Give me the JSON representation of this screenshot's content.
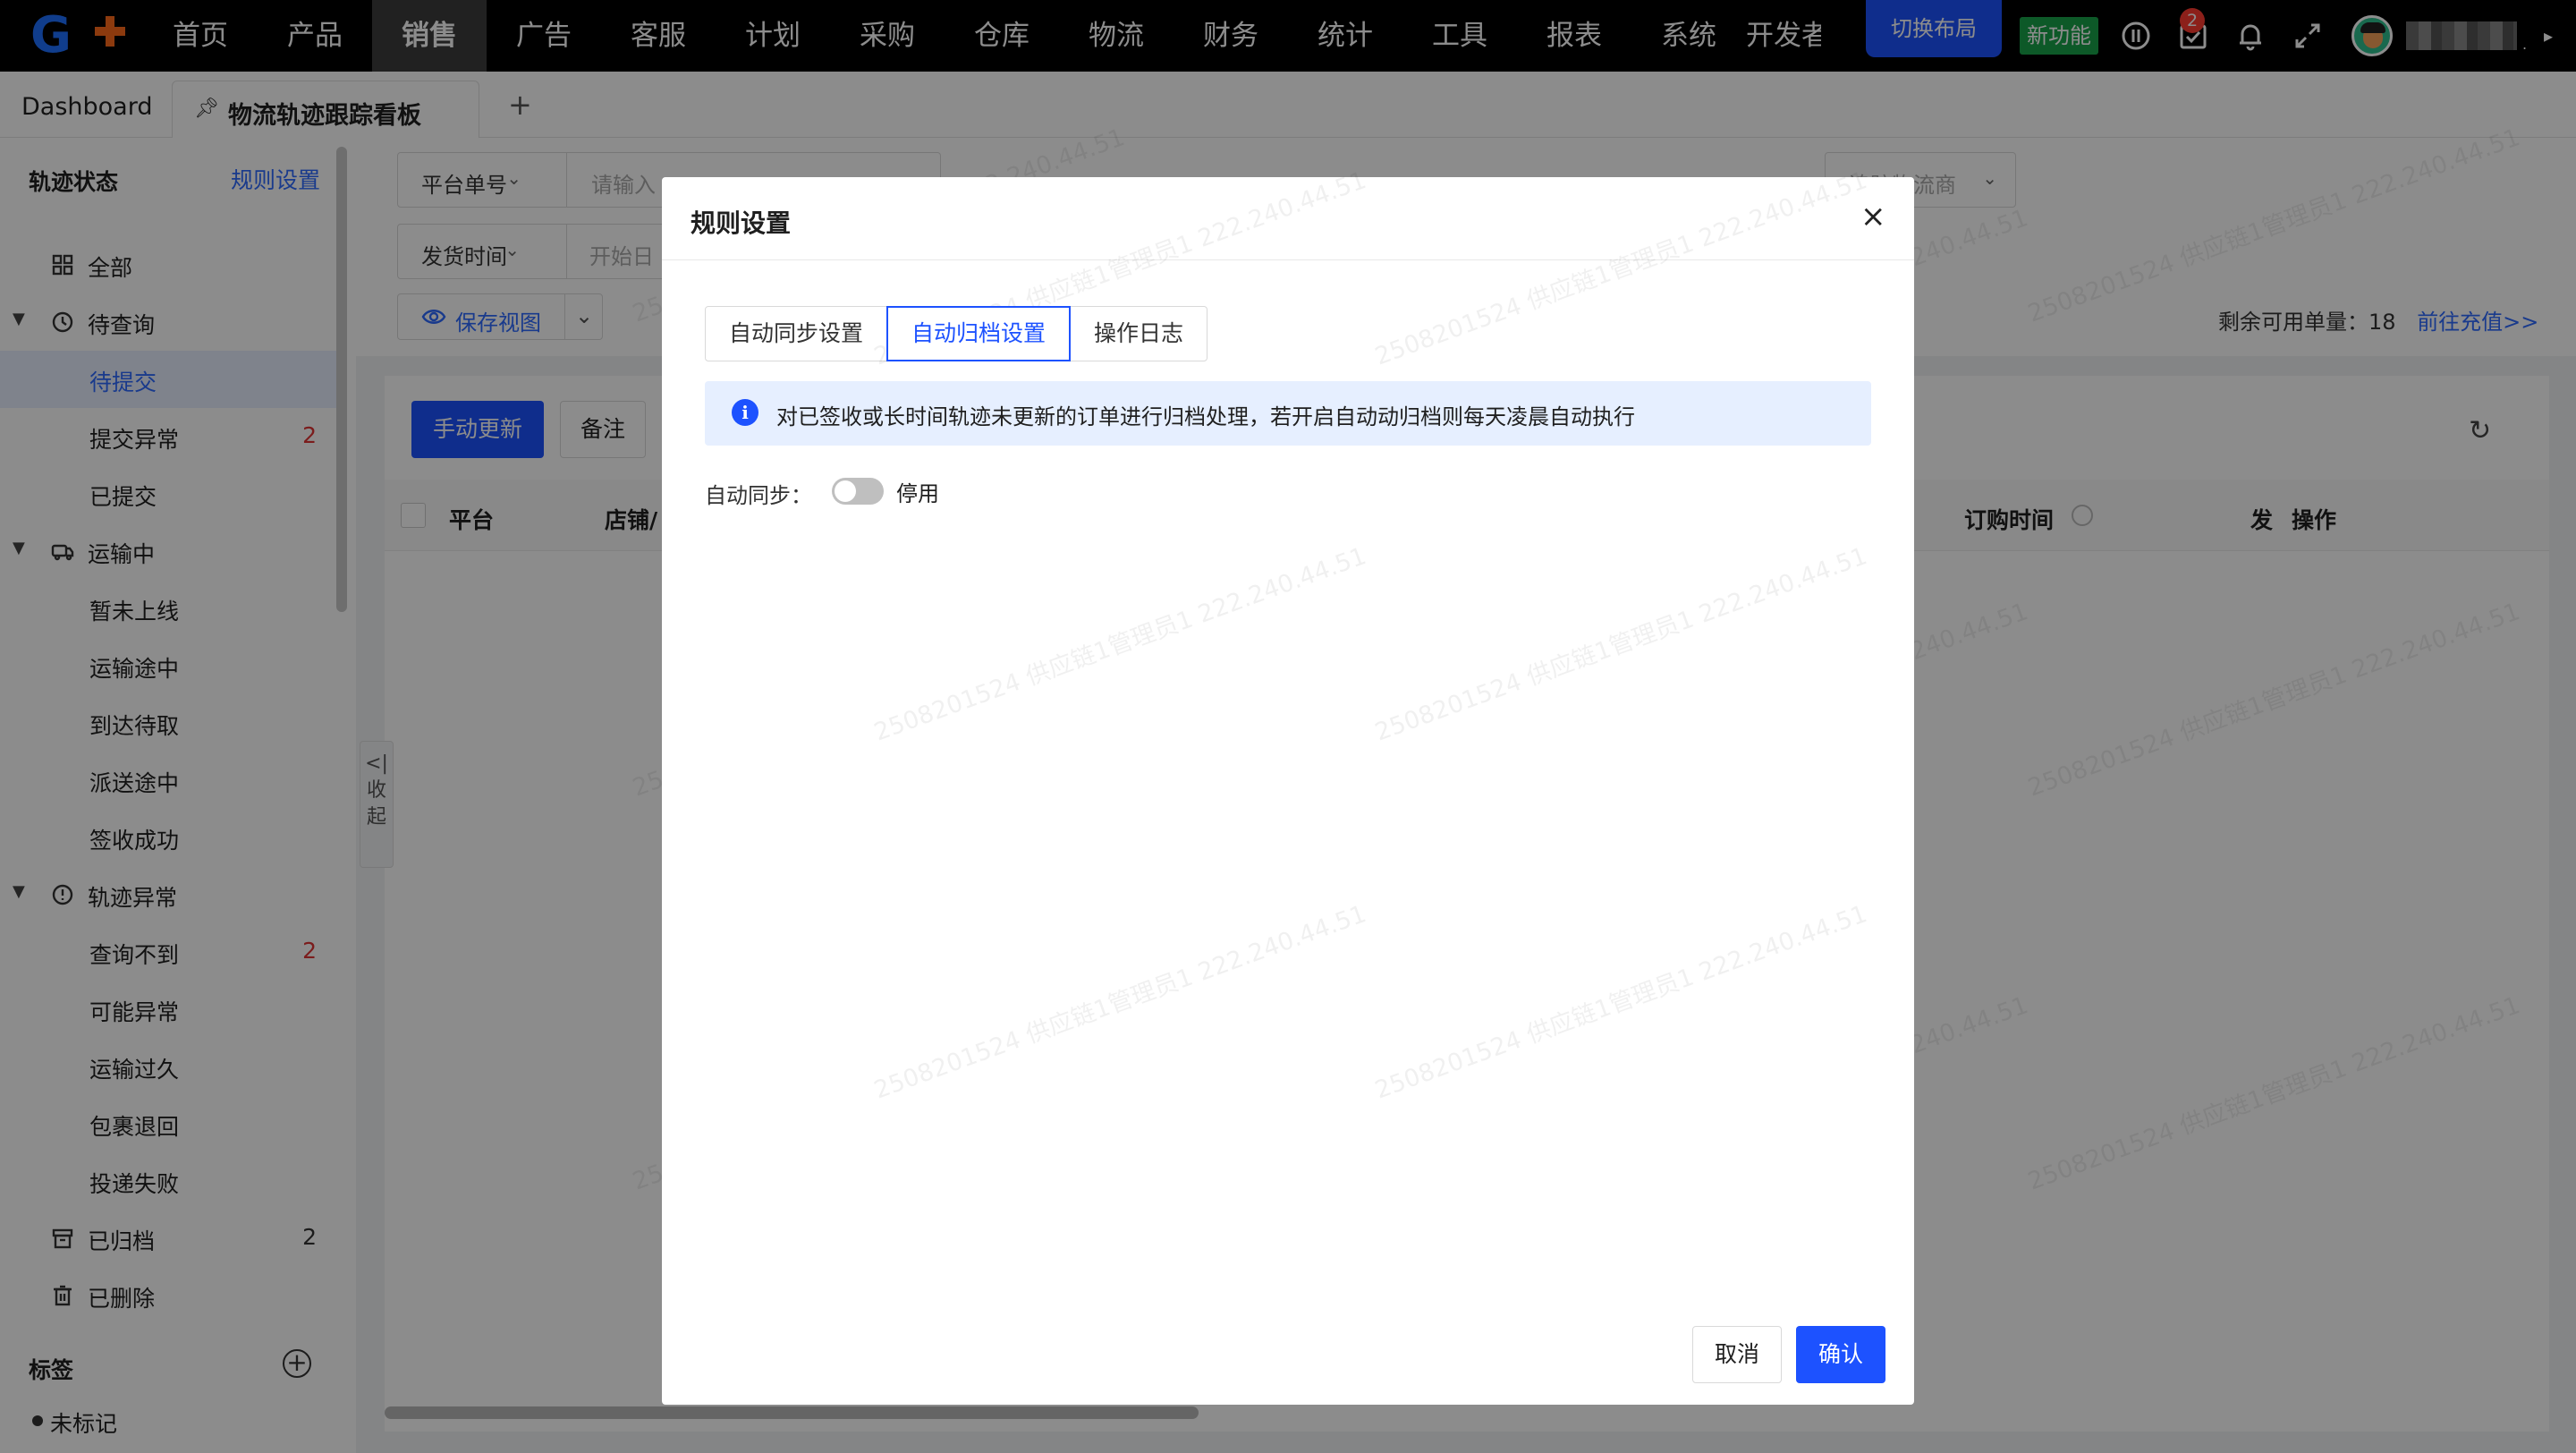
{
  "nav": {
    "items": [
      "首页",
      "产品",
      "销售",
      "广告",
      "客服",
      "计划",
      "采购",
      "仓库",
      "物流",
      "财务",
      "统计",
      "工具",
      "报表",
      "系统",
      "开发者"
    ],
    "active_index": 2,
    "switch_layout": "切换布局",
    "new_feature": "新功能",
    "task_badge": "2",
    "user_name_masked": "."
  },
  "tabs": {
    "dashboard": "Dashboard",
    "active": "物流轨迹跟踪看板",
    "add": "+"
  },
  "sidebar": {
    "title": "轨迹状态",
    "rule_link": "规则设置",
    "items": [
      {
        "label": "全部",
        "count": ""
      },
      {
        "label": "待查询",
        "count": ""
      },
      {
        "label": "待提交",
        "count": ""
      },
      {
        "label": "提交异常",
        "count": "2"
      },
      {
        "label": "已提交",
        "count": ""
      },
      {
        "label": "运输中",
        "count": ""
      },
      {
        "label": "暂未上线",
        "count": ""
      },
      {
        "label": "运输途中",
        "count": ""
      },
      {
        "label": "到达待取",
        "count": ""
      },
      {
        "label": "派送途中",
        "count": ""
      },
      {
        "label": "签收成功",
        "count": ""
      },
      {
        "label": "轨迹异常",
        "count": ""
      },
      {
        "label": "查询不到",
        "count": "2"
      },
      {
        "label": "可能异常",
        "count": ""
      },
      {
        "label": "运输过久",
        "count": ""
      },
      {
        "label": "包裹退回",
        "count": ""
      },
      {
        "label": "投递失败",
        "count": ""
      },
      {
        "label": "已归档",
        "count": "2"
      },
      {
        "label": "已删除",
        "count": ""
      }
    ],
    "tags_title": "标签",
    "tag_unmarked": "未标记",
    "collapse": "收起"
  },
  "filters": {
    "platform_order": "平台单号",
    "input_placeholder": "请输入",
    "ship_time": "发货时间",
    "start_date": "开始日",
    "logistics": "追踪物流商",
    "save_view": "保存视图",
    "remain_label": "剩余可用单量：",
    "remain_value": "18",
    "recharge": "前往充值>>"
  },
  "toolbar": {
    "manual_update": "手动更新",
    "note": "备注"
  },
  "table": {
    "headers": [
      "平台",
      "店铺/",
      "订购时间",
      "发",
      "操作"
    ]
  },
  "watermark": "2508201524 供应链1管理员1 222.240.44.51",
  "modal": {
    "title": "规则设置",
    "tabs": [
      "自动同步设置",
      "自动归档设置",
      "操作日志"
    ],
    "active_tab": 1,
    "alert": "对已签收或长时间轨迹未更新的订单进行归档处理，若开启自动动归档则每天凌晨自动执行",
    "sync_label": "自动同步：",
    "toggle_state": "停用",
    "cancel": "取消",
    "confirm": "确认"
  },
  "colors": {
    "primary": "#1d52ff",
    "nav_bg": "#000000",
    "new_feature_bg": "#19a34a",
    "badge": "#ff3b30",
    "count_red": "#e03333"
  }
}
